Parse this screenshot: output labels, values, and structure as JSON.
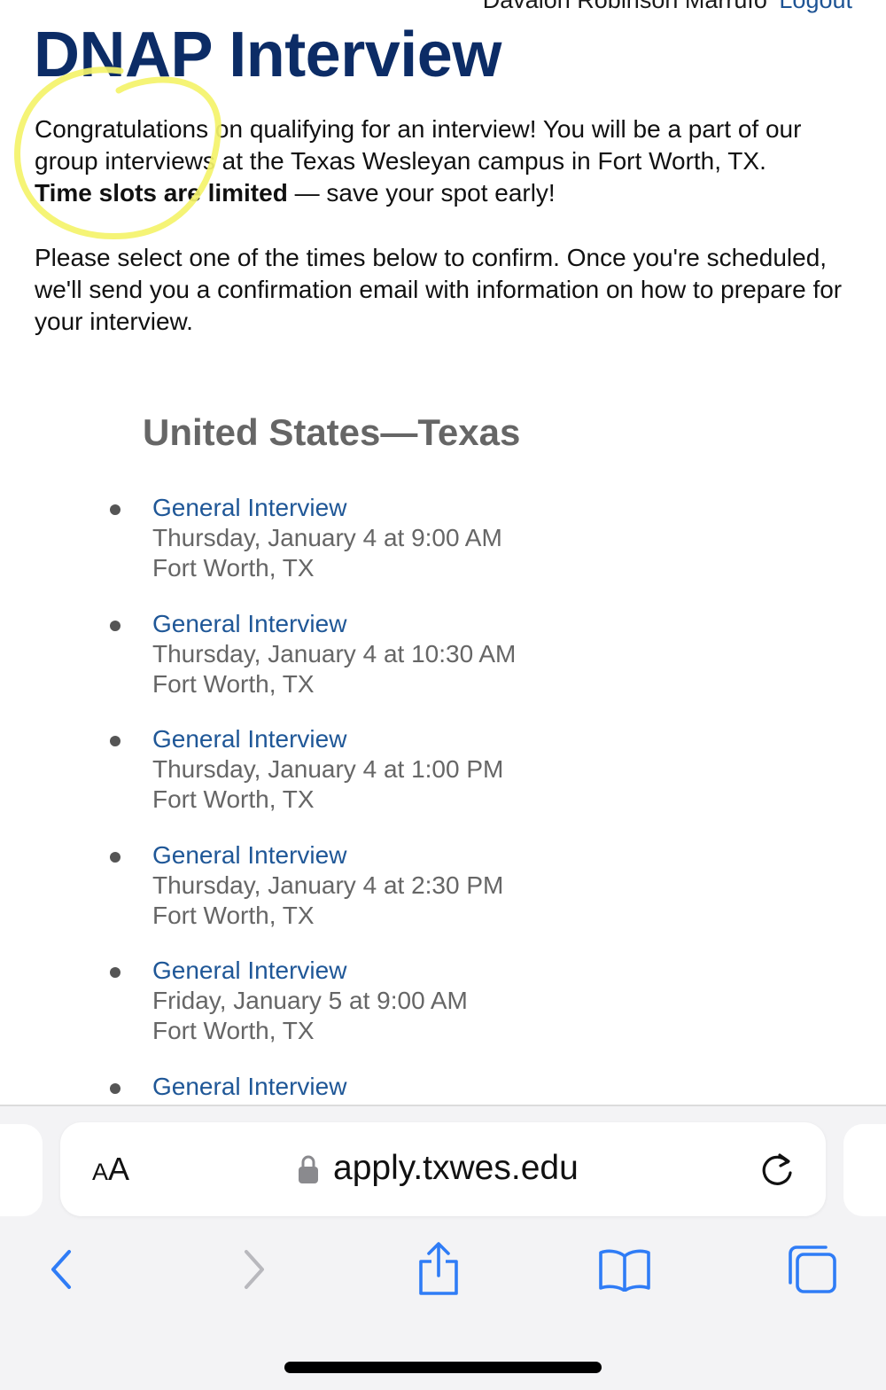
{
  "header": {
    "user_name": "Davalon Robinson Marrufo",
    "logout_label": "Logout"
  },
  "page": {
    "title": "DNAP Interview",
    "intro_text": "Congratulations on qualifying for an interview! You will be a part of our group interviews at the Texas Wesleyan campus in Fort Worth, TX.",
    "limited_bold": "Time slots are limited",
    "limited_rest": " — save your spot early!",
    "instructions": "Please select one of the times below to confirm. Once you're scheduled, we'll send you a confirmation email with information on how to prepare for your interview.",
    "annotation_color": "#f4f36a"
  },
  "region": {
    "heading": "United States—Texas"
  },
  "slots": [
    {
      "title": "General Interview",
      "datetime": "Thursday, January 4 at 9:00 AM",
      "location": "Fort Worth, TX"
    },
    {
      "title": "General Interview",
      "datetime": "Thursday, January 4 at 10:30 AM",
      "location": "Fort Worth, TX"
    },
    {
      "title": "General Interview",
      "datetime": "Thursday, January 4 at 1:00 PM",
      "location": "Fort Worth, TX"
    },
    {
      "title": "General Interview",
      "datetime": "Thursday, January 4 at 2:30 PM",
      "location": "Fort Worth, TX"
    },
    {
      "title": "General Interview",
      "datetime": "Friday, January 5 at 9:00 AM",
      "location": "Fort Worth, TX"
    },
    {
      "title": "General Interview"
    }
  ],
  "browser": {
    "text_size_label_big": "A",
    "text_size_label_small": "A",
    "url": "apply.txwes.edu",
    "icons": {
      "text_size": "aa-icon",
      "lock": "lock-icon",
      "reload": "reload-icon",
      "back": "chevron-left-icon",
      "forward": "chevron-right-icon",
      "share": "share-icon",
      "bookmarks": "book-icon",
      "tabs": "tabs-icon"
    },
    "accent_color": "#2f7cf6",
    "disabled_color": "#b8b8bd"
  }
}
